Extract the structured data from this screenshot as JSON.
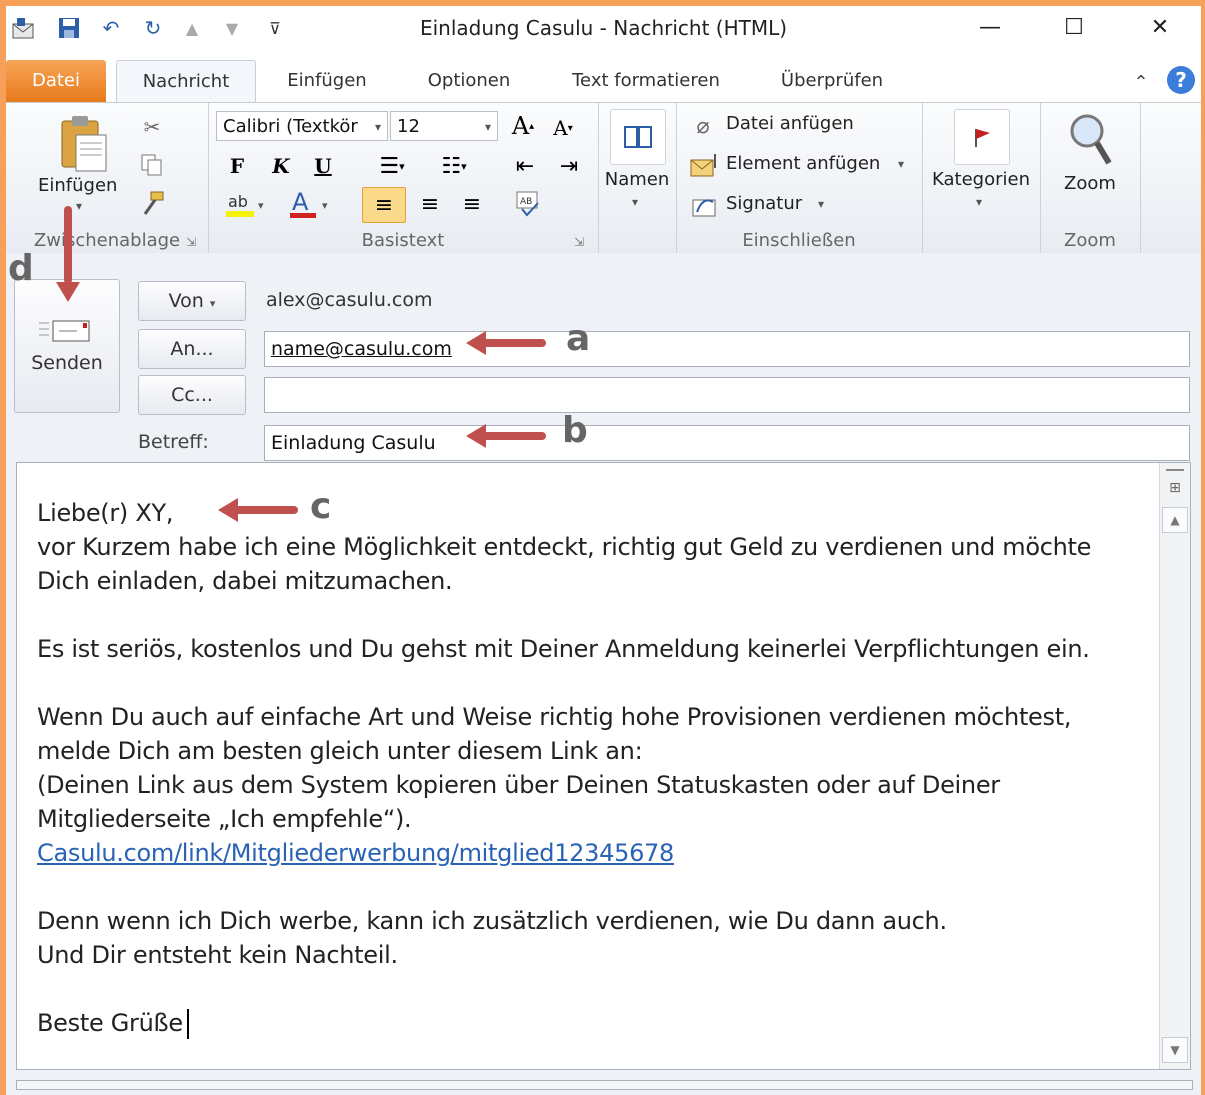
{
  "window": {
    "title": "Einladung Casulu  -  Nachricht (HTML)"
  },
  "tabs": [
    "Datei",
    "Nachricht",
    "Einfügen",
    "Optionen",
    "Text formatieren",
    "Überprüfen"
  ],
  "ribbon": {
    "clipboard": {
      "paste_label": "Einfügen",
      "group_label": "Zwischenablage"
    },
    "basictext": {
      "font": "Calibri (Textkör",
      "size": "12",
      "bold": "F",
      "italic": "K",
      "underline": "U",
      "group_label": "Basistext"
    },
    "names": {
      "label": "Namen"
    },
    "include": {
      "attach_file": "Datei anfügen",
      "attach_item": "Element anfügen",
      "signature": "Signatur",
      "group_label": "Einschließen"
    },
    "categories": {
      "label": "Kategorien"
    },
    "zoom": {
      "label": "Zoom",
      "group_label": "Zoom"
    }
  },
  "header": {
    "send_label": "Senden",
    "from_label": "Von",
    "from_value": "alex@casulu.com",
    "to_label": "An...",
    "to_value": "name@casulu.com",
    "cc_label": "Cc...",
    "cc_value": "",
    "subject_label": "Betreff:",
    "subject_value": "Einladung Casulu"
  },
  "annotations": {
    "a": "a",
    "b": "b",
    "c": "c",
    "d": "d"
  },
  "body": {
    "lines": [
      "Liebe(r) XY,",
      "vor Kurzem habe ich eine Möglichkeit entdeckt, richtig gut Geld zu verdienen und möchte",
      "Dich einladen, dabei mitzumachen.",
      "Es ist seriös, kostenlos und Du gehst mit Deiner Anmeldung keinerlei Verpflichtungen ein.",
      "Wenn Du auch auf einfache Art und Weise richtig hohe Provisionen verdienen möchtest,",
      "melde Dich am besten gleich unter diesem Link an:",
      "(Deinen Link aus dem System kopieren über Deinen Statuskasten oder auf Deiner",
      "Mitgliederseite „Ich empfehle“).",
      "Casulu.com/link/Mitgliederwerbung/mitglied12345678",
      "Denn wenn ich Dich werbe, kann ich zusätzlich verdienen, wie Du dann auch.",
      "Und Dir entsteht kein Nachteil.",
      "Beste Grüße"
    ]
  }
}
